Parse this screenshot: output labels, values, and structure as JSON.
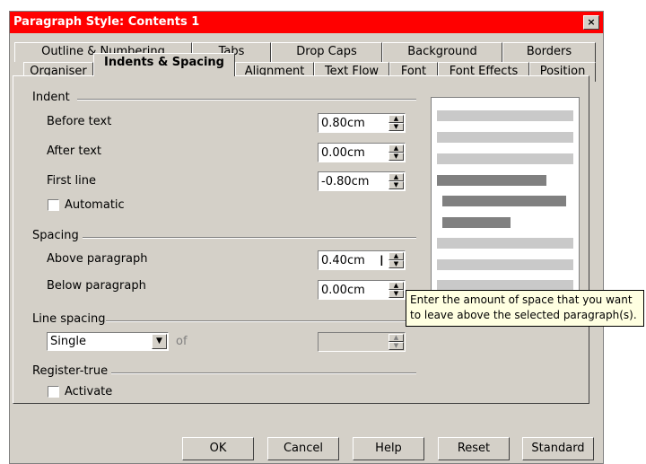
{
  "window": {
    "title": "Paragraph Style: Contents 1",
    "close_label": "×"
  },
  "tabs_row1": [
    "Outline & Numbering",
    "Tabs",
    "Drop Caps",
    "Background",
    "Borders"
  ],
  "tabs_row2": [
    "Organiser",
    "Indents & Spacing",
    "Alignment",
    "Text Flow",
    "Font",
    "Font Effects",
    "Position"
  ],
  "indent": {
    "heading": "Indent",
    "before_text": {
      "label": "Before text",
      "value": "0.80cm"
    },
    "after_text": {
      "label": "After text",
      "value": "0.00cm"
    },
    "first_line": {
      "label": "First line",
      "value": "-0.80cm"
    },
    "automatic_label": "Automatic"
  },
  "spacing": {
    "heading": "Spacing",
    "above": {
      "label": "Above paragraph",
      "value": "0.40cm"
    },
    "below": {
      "label": "Below paragraph",
      "value": "0.00cm"
    }
  },
  "line_spacing": {
    "heading": "Line spacing",
    "selected": "Single",
    "of_label": "of",
    "value": ""
  },
  "register_true": {
    "heading": "Register-true",
    "activate_label": "Activate"
  },
  "tooltip": {
    "line1": "Enter the amount of space that you want",
    "line2": "to leave above the selected paragraph(s)."
  },
  "buttons": {
    "ok": "OK",
    "cancel": "Cancel",
    "help": "Help",
    "reset": "Reset",
    "standard": "Standard"
  },
  "colors": {
    "titlebar": "#ff0000",
    "dialog_bg": "#d4d0c8",
    "tooltip_bg": "#ffffe1"
  }
}
